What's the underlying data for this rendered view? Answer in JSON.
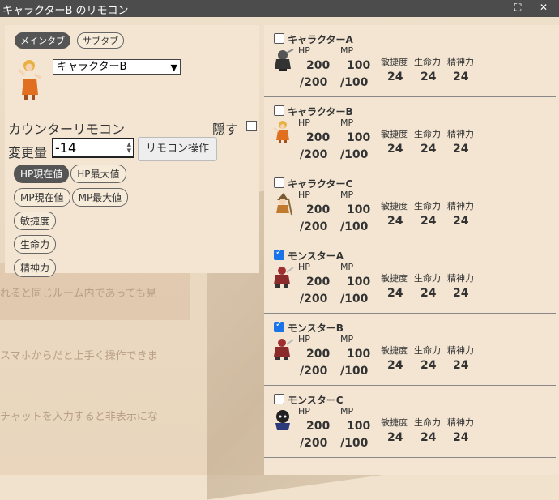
{
  "window": {
    "title": "キャラクターB のリモコン"
  },
  "background": {
    "lines": [
      "れると同じルーム内であっても見",
      "スマホからだと上手く操作できま",
      "チャットを入力すると非表示にな"
    ]
  },
  "left": {
    "tabs": [
      "メインタブ",
      "サブタブ"
    ],
    "select_value": "キャラクターB",
    "heading": "カウンターリモコン",
    "hide_label": "隠す",
    "amount_label": "変更量",
    "amount_value": "-14",
    "operate_button": "リモコン操作",
    "stat_buttons": [
      "HP現在値",
      "HP最大値",
      "MP現在値",
      "MP最大値",
      "敏捷度",
      "生命力",
      "精神力"
    ]
  },
  "labels": {
    "hp": "HP",
    "mp": "MP",
    "agi": "敏捷度",
    "vit": "生命力",
    "spi": "精神力"
  },
  "characters": [
    {
      "name": "キャラクターA",
      "checked": false,
      "hp": "200",
      "hp_max": "/200",
      "mp": "100",
      "mp_max": "/100",
      "agi": "24",
      "vit": "24",
      "spi": "24"
    },
    {
      "name": "キャラクターB",
      "checked": false,
      "hp": "200",
      "hp_max": "/200",
      "mp": "100",
      "mp_max": "/100",
      "agi": "24",
      "vit": "24",
      "spi": "24"
    },
    {
      "name": "キャラクターC",
      "checked": false,
      "hp": "200",
      "hp_max": "/200",
      "mp": "100",
      "mp_max": "/100",
      "agi": "24",
      "vit": "24",
      "spi": "24"
    },
    {
      "name": "モンスターA",
      "checked": true,
      "hp": "200",
      "hp_max": "/200",
      "mp": "100",
      "mp_max": "/100",
      "agi": "24",
      "vit": "24",
      "spi": "24"
    },
    {
      "name": "モンスターB",
      "checked": true,
      "hp": "200",
      "hp_max": "/200",
      "mp": "100",
      "mp_max": "/100",
      "agi": "24",
      "vit": "24",
      "spi": "24"
    },
    {
      "name": "モンスターC",
      "checked": false,
      "hp": "200",
      "hp_max": "/200",
      "mp": "100",
      "mp_max": "/100",
      "agi": "24",
      "vit": "24",
      "spi": "24"
    }
  ]
}
